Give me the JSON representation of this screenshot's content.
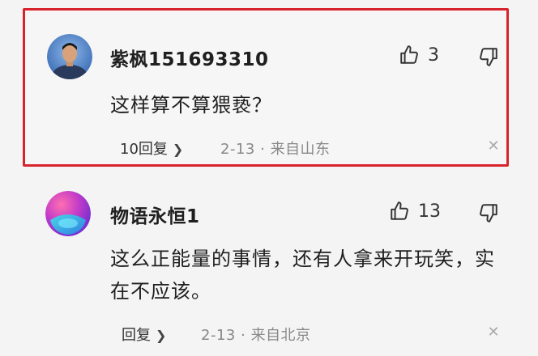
{
  "comments": [
    {
      "username": "紫枫151693310",
      "likes": "3",
      "content": "这样算不算猥亵？",
      "reply_label": "10回复",
      "date": "2-13",
      "separator": "·",
      "location": "来自山东",
      "highlighted": true,
      "highlight_color": "#d7232b"
    },
    {
      "username": "物语永恒1",
      "likes": "13",
      "content": "这么正能量的事情，还有人拿来开玩笑，实在不应该。",
      "reply_label": "回复",
      "date": "2-13",
      "separator": "·",
      "location": "来自北京",
      "highlighted": false
    }
  ],
  "icons": {
    "like": "thumbs-up-icon",
    "dislike": "thumbs-down-icon",
    "close": "close-icon",
    "chevron": "chevron-right-icon"
  }
}
